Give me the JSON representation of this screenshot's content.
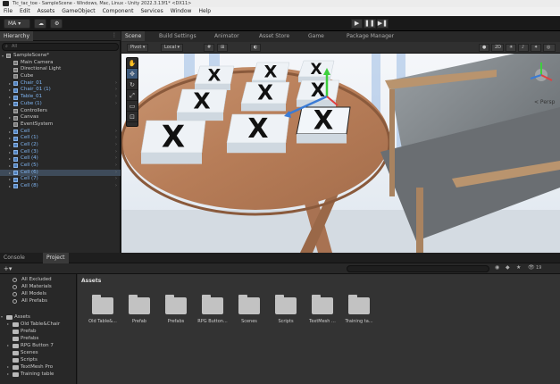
{
  "window": {
    "title": "Tic_tac_toe - SampleScene - Windows, Mac, Linux - Unity 2022.3.13f1* <DX11>"
  },
  "menu": [
    "File",
    "Edit",
    "Assets",
    "GameObject",
    "Component",
    "Services",
    "Window",
    "Help"
  ],
  "toolbar": {
    "account": "MA ▾",
    "play": "▶",
    "pause": "❚❚",
    "step": "▶❚"
  },
  "hierarchy": {
    "tab": "Hierarchy",
    "search_placeholder": "All",
    "items": [
      {
        "label": "SampleScene*",
        "indent": 0,
        "expand": "▾",
        "kind": "scene"
      },
      {
        "label": "Main Camera",
        "indent": 1,
        "kind": "gray"
      },
      {
        "label": "Directional Light",
        "indent": 1,
        "kind": "gray"
      },
      {
        "label": "Cube",
        "indent": 1,
        "kind": "gray"
      },
      {
        "label": "Chair_01",
        "indent": 1,
        "expand": "▸",
        "kind": "blue"
      },
      {
        "label": "Chair_01 (1)",
        "indent": 1,
        "expand": "▸",
        "kind": "blue"
      },
      {
        "label": "Table_01",
        "indent": 1,
        "expand": "▸",
        "kind": "blue"
      },
      {
        "label": "Cube (1)",
        "indent": 1,
        "expand": "▸",
        "kind": "blue"
      },
      {
        "label": "Controllers",
        "indent": 1,
        "kind": "gray"
      },
      {
        "label": "Canvas",
        "indent": 1,
        "expand": "▸",
        "kind": "gray"
      },
      {
        "label": "EventSystem",
        "indent": 1,
        "kind": "gray"
      },
      {
        "label": "Cell",
        "indent": 1,
        "expand": "▸",
        "kind": "blue"
      },
      {
        "label": "Cell (1)",
        "indent": 1,
        "expand": "▸",
        "kind": "blue"
      },
      {
        "label": "Cell (2)",
        "indent": 1,
        "expand": "▸",
        "kind": "blue"
      },
      {
        "label": "Cell (3)",
        "indent": 1,
        "expand": "▸",
        "kind": "blue"
      },
      {
        "label": "Cell (4)",
        "indent": 1,
        "expand": "▸",
        "kind": "blue"
      },
      {
        "label": "Cell (5)",
        "indent": 1,
        "expand": "▸",
        "kind": "blue"
      },
      {
        "label": "Cell (6)",
        "indent": 1,
        "expand": "▸",
        "kind": "blue",
        "selected": true
      },
      {
        "label": "Cell (7)",
        "indent": 1,
        "expand": "▸",
        "kind": "blue"
      },
      {
        "label": "Cell (8)",
        "indent": 1,
        "expand": "▸",
        "kind": "blue"
      }
    ]
  },
  "scene": {
    "tabs": [
      "Scene",
      "Build Settings",
      "Animator",
      "Asset Store",
      "Game",
      "Package Manager"
    ],
    "tools": {
      "pivot": "Pivot ▾",
      "local": "Local ▾",
      "persp": "< Persp",
      "d2": "2D"
    },
    "board": [
      "X",
      "X",
      "X",
      "X",
      "X",
      "X",
      "X",
      "X",
      "X"
    ]
  },
  "project": {
    "tabs": [
      "Console",
      "Project"
    ],
    "favorites": [
      "All Excluded",
      "All Materials",
      "All Models",
      "All Prefabs"
    ],
    "tree": [
      {
        "label": "Assets",
        "indent": 0,
        "expand": "▾"
      },
      {
        "label": "Old Table&Chair",
        "indent": 1,
        "expand": "▸"
      },
      {
        "label": "Prefab",
        "indent": 1
      },
      {
        "label": "Prefabs",
        "indent": 1
      },
      {
        "label": "RPG Button 7",
        "indent": 1,
        "expand": "▸"
      },
      {
        "label": "Scenes",
        "indent": 1
      },
      {
        "label": "Scripts",
        "indent": 1
      },
      {
        "label": "TextMesh Pro",
        "indent": 1,
        "expand": "▸"
      },
      {
        "label": "Training table",
        "indent": 1,
        "expand": "▸"
      }
    ],
    "breadcrumb": "Assets",
    "assets": [
      "Old Table&...",
      "Prefab",
      "Prefabs",
      "RPG Button...",
      "Scenes",
      "Scripts",
      "TextMesh ...",
      "Training ta..."
    ],
    "counter": "19"
  }
}
